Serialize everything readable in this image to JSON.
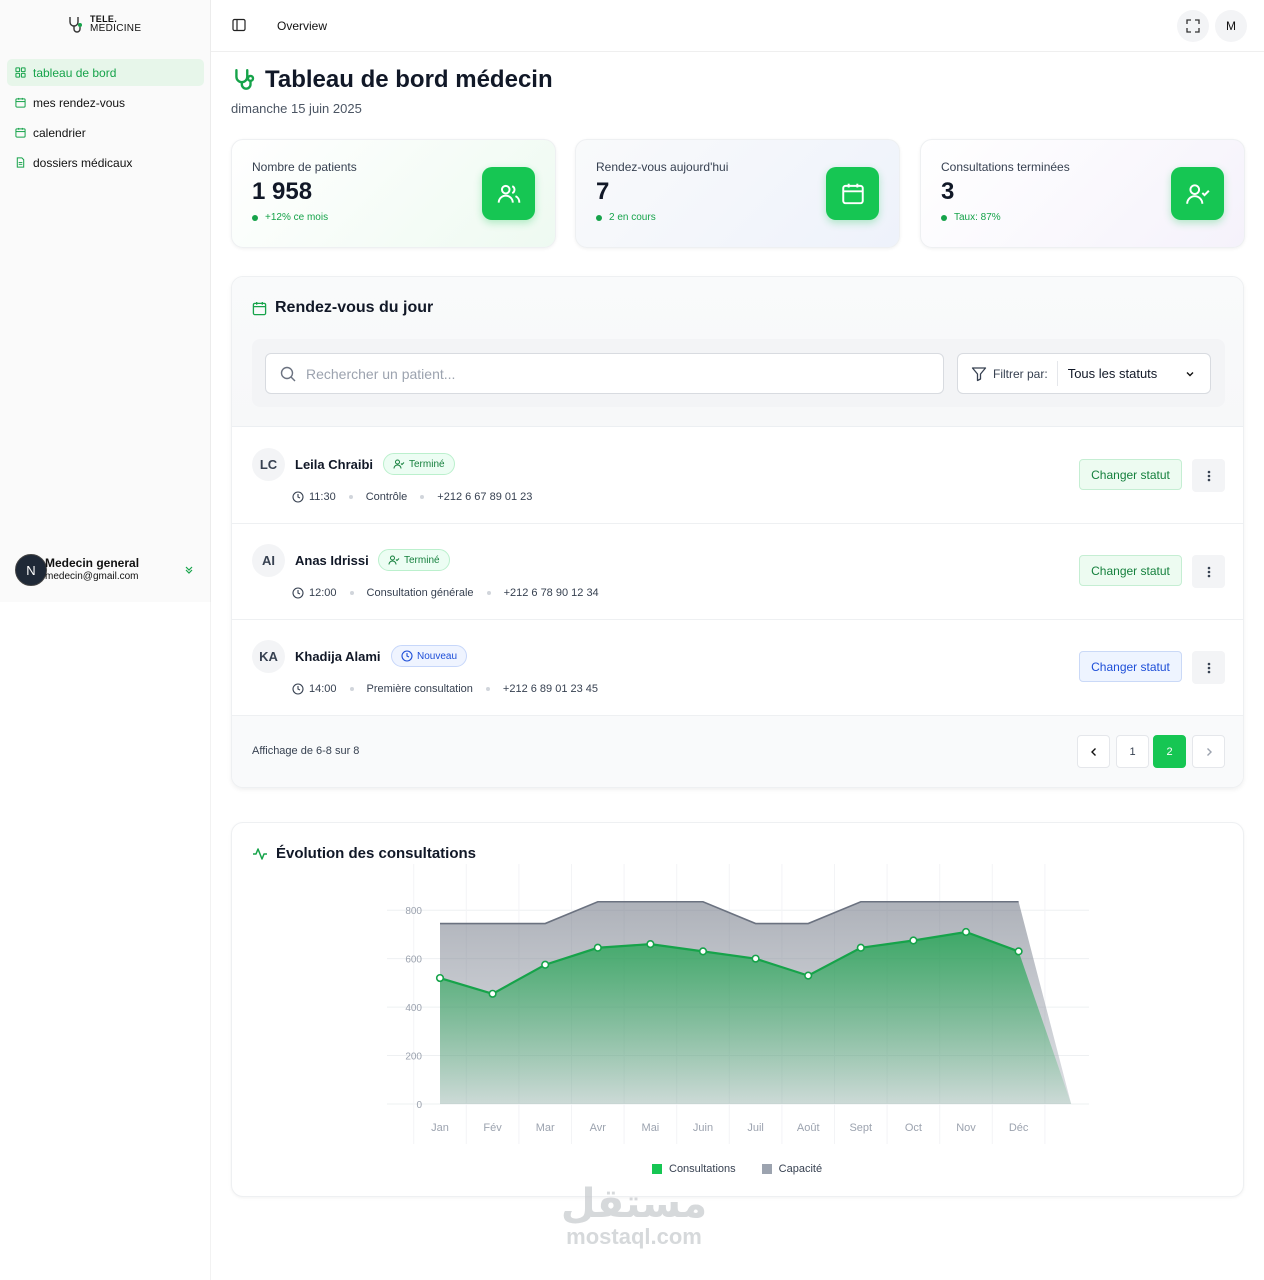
{
  "app": {
    "logo_line1": "TELE.",
    "logo_line2": "MEDICINE"
  },
  "sidebar": {
    "items": [
      {
        "label": "tableau de bord",
        "icon": "dashboard-icon",
        "active": true
      },
      {
        "label": "mes rendez-vous",
        "icon": "calendar-icon",
        "active": false
      },
      {
        "label": "calendrier",
        "icon": "calendar-icon",
        "active": false
      },
      {
        "label": "dossiers médicaux",
        "icon": "file-icon",
        "active": false
      }
    ],
    "user": {
      "initial": "N",
      "name": "Medecin general",
      "email": "medecin@gmail.com"
    }
  },
  "topbar": {
    "title": "Overview",
    "avatar_initial": "M"
  },
  "page": {
    "title": "Tableau de bord médecin",
    "date": "dimanche 15 juin 2025"
  },
  "stats": [
    {
      "label": "Nombre de patients",
      "value": "1 958",
      "trend": "+12% ce mois",
      "icon": "users-icon"
    },
    {
      "label": "Rendez-vous aujourd'hui",
      "value": "7",
      "trend": "2 en cours",
      "icon": "calendar-icon"
    },
    {
      "label": "Consultations terminées",
      "value": "3",
      "trend": "Taux: 87%",
      "icon": "user-check-icon"
    }
  ],
  "appointments_section": {
    "title": "Rendez-vous du jour",
    "search_placeholder": "Rechercher un patient...",
    "filter_label": "Filtrer par:",
    "filter_value": "Tous les statuts",
    "change_status_label": "Changer statut",
    "items": [
      {
        "initials": "LC",
        "name": "Leila Chraibi",
        "status": "Terminé",
        "time": "11:30",
        "type": "Contrôle",
        "phone": "+212 6 67 89 01 23"
      },
      {
        "initials": "AI",
        "name": "Anas Idrissi",
        "status": "Terminé",
        "time": "12:00",
        "type": "Consultation générale",
        "phone": "+212 6 78 90 12 34"
      },
      {
        "initials": "KA",
        "name": "Khadija Alami",
        "status": "Nouveau",
        "time": "14:00",
        "type": "Première consultation",
        "phone": "+212 6 89 01 23 45"
      }
    ],
    "footer_text": "Affichage de 6-8 sur 8",
    "pages": [
      "1",
      "2"
    ],
    "current_page": "2"
  },
  "chart_section": {
    "title": "Évolution des consultations"
  },
  "chart_data": {
    "type": "area",
    "categories": [
      "Jan",
      "Fév",
      "Mar",
      "Avr",
      "Mai",
      "Juin",
      "Juil",
      "Août",
      "Sept",
      "Oct",
      "Nov",
      "Déc"
    ],
    "series": [
      {
        "name": "Consultations",
        "values": [
          520,
          455,
          575,
          645,
          660,
          630,
          600,
          530,
          645,
          675,
          710,
          630
        ],
        "color": "#16c653"
      },
      {
        "name": "Capacité",
        "values": [
          745,
          745,
          745,
          835,
          835,
          835,
          745,
          745,
          835,
          835,
          835,
          835
        ],
        "color": "#9ca3af"
      }
    ],
    "y_ticks": [
      0,
      200,
      400,
      600,
      800
    ],
    "ylim": [
      0,
      900
    ],
    "grid": true,
    "legend_position": "bottom"
  },
  "watermark": {
    "arabic": "مستقل",
    "latin": "mostaql.com"
  }
}
